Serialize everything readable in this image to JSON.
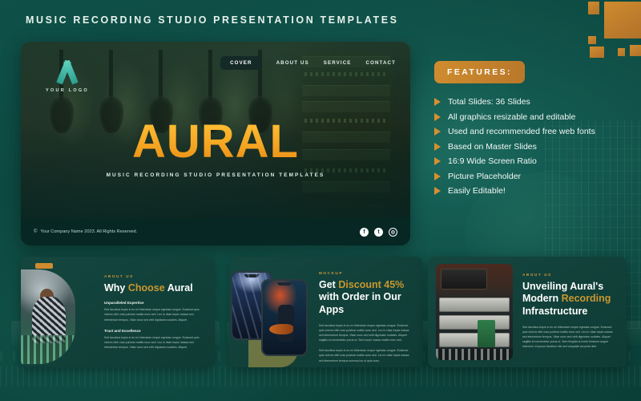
{
  "page": {
    "title": "MUSIC RECORDING STUDIO PRESENTATION TEMPLATES",
    "bg_color": "#0d4a42",
    "accent_gold": "#d08b2e",
    "accent_teal": "#2c9e8e"
  },
  "hero": {
    "logo_text": "YOUR LOGO",
    "nav": [
      {
        "label": "COVER",
        "active": true
      },
      {
        "label": "ABOUT US",
        "active": false
      },
      {
        "label": "SERVICE",
        "active": false
      },
      {
        "label": "CONTACT",
        "active": false
      }
    ],
    "title": "AURAL",
    "subtitle": "MUSIC  RECORDING STUDIO PRESENTATION TEMPLATES",
    "copyright_symbol": "©",
    "copyright": "Your Company Name 2023. All Rights Reserved.",
    "social": [
      {
        "name": "facebook-icon",
        "glyph": "f"
      },
      {
        "name": "twitter-icon",
        "glyph": "t"
      },
      {
        "name": "instagram-icon",
        "glyph": "◎"
      }
    ]
  },
  "features": {
    "heading": "FEATURES:",
    "items": [
      "Total Slides: 36 Slides",
      "All graphics resizable and editable",
      "Used and recommended free web fonts",
      "Based on Master Slides",
      "16:9 Wide Screen Ratio",
      "Picture Placeholder",
      "Easily Editable!"
    ]
  },
  "cards": [
    {
      "eyebrow": "ABOUT US",
      "title_pre": "Why ",
      "title_gold": "Choose",
      "title_post": " Aural",
      "sections": [
        {
          "subheading": "Unparalleled Expertise",
          "body": "Sed faucibus turpis in eu mi bibendum neque egestas congue. Euismod quis viverra nibh cras pulvinar mattis nunc sed. Leo in vitae turpis massa sed elementum tempus. Vitae nunc sed velit dignissim sodales. Aliquet."
        },
        {
          "subheading": "Trust and Excellence",
          "body": "Sed faucibus turpis in eu mi bibendum neque egestas congue. Euismod quis viverra nibh cras pulvinar mattis nunc sed. Leo in vitae turpis massa sed elementum tempus. Vitae nunc sed velit dignissim sodales. Aliquet."
        }
      ]
    },
    {
      "eyebrow": "MOCKUP",
      "title_pre": "Get ",
      "title_gold": "Discount 45%",
      "title_post": " with Order in Our Apps",
      "sections": [
        {
          "subheading": "",
          "body": "Sed faucibus turpis in eu mi bibendum neque egestas congue. Euismod quis viverra nibh cras pulvinar mattis nunc sed. Leo in vitae turpis massa sed elementum tempus. Vitae nunc sed velit dignissim sodales. Aliquet sagittis id consectetur purus ut. Sem turpis massa mattis nunc sed."
        },
        {
          "subheading": "",
          "body": "Sed faucibus turpis in eu mi bibendum neque egestas congue. Euismod quis viverra nibh cras pulvinar mattis nunc sed. Leo in vitae turpis massa sed elementum tempus euismod ac ut quis nunc."
        }
      ]
    },
    {
      "eyebrow": "ABOUT US",
      "title_pre": "Unveiling Aural's Modern ",
      "title_gold": "Recording",
      "title_post": " Infrastructure",
      "sections": [
        {
          "subheading": "",
          "body": "Sed faucibus turpis in eu mi bibendum neque egestas congue. Euismod quis viverra nibh cras pulvinar mattis nunc sed. Leo in vitae turpis massa sed elementum tempus. Vitae nunc sed velit dignissim sodales. Aliquet sagittis id consectetur purus ut. Sem fringilla ut morbi tincidunt augue interdum. Id ipsum faucibus nisl sed voluptate ad porta nibh."
        }
      ]
    }
  ]
}
